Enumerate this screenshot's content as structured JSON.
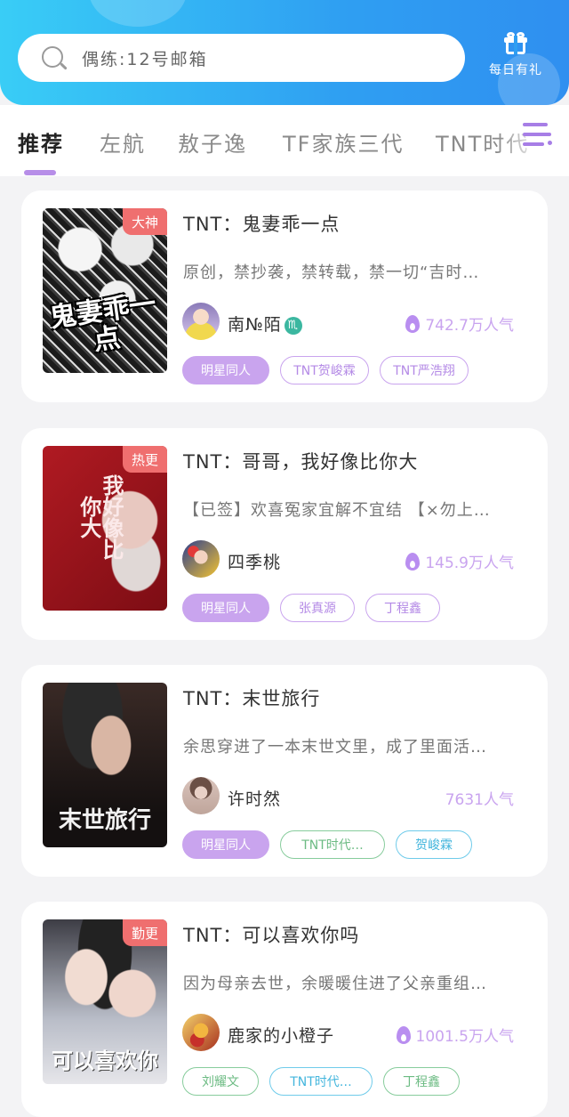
{
  "header": {
    "search_placeholder": "偶练:12号邮箱",
    "gift_label": "每日有礼",
    "icons": {
      "search": "search-icon",
      "gift": "gift-icon"
    }
  },
  "tabs": [
    {
      "label": "推荐",
      "active": true
    },
    {
      "label": "左航",
      "active": false
    },
    {
      "label": "敖子逸",
      "active": false
    },
    {
      "label": "TF家族三代",
      "active": false
    },
    {
      "label": "TNT时代",
      "active": false
    }
  ],
  "books": [
    {
      "badge": "大神",
      "cover_text": "鬼妻乖一点",
      "title": "TNT：鬼妻乖一点",
      "desc": "原创，禁抄袭，禁转载，禁一切“吉时…",
      "author": "南№陌",
      "author_badge": "♏",
      "popularity": "742.7万人气",
      "tags": [
        "明星同人",
        "TNT贺峻霖",
        "TNT严浩翔"
      ]
    },
    {
      "badge": "热更",
      "cover_text": "我好像比你大",
      "title": "TNT：哥哥，我好像比你大",
      "desc": "【已签】欢喜冤家宜解不宜结 【×勿上…",
      "author": "四季桃",
      "popularity": "145.9万人气",
      "tags": [
        "明星同人",
        "张真源",
        "丁程鑫"
      ]
    },
    {
      "badge": "",
      "cover_text": "末世旅行",
      "title": "TNT：末世旅行",
      "desc": "余思穿进了一本末世文里，成了里面活…",
      "author": "许时然",
      "popularity": "7631人气",
      "tags": [
        "明星同人",
        "TNT时代…",
        "贺峻霖"
      ]
    },
    {
      "badge": "勤更",
      "cover_text": "可以喜欢你",
      "title": "TNT：可以喜欢你吗",
      "desc": "因为母亲去世，余暖暖住进了父亲重组…",
      "author": "鹿家的小橙子",
      "popularity": "1001.5万人气",
      "tags": [
        "刘耀文",
        "TNT时代…",
        "丁程鑫"
      ]
    }
  ],
  "colors": {
    "header_start": "#39cdf6",
    "header_end": "#2f8ff0",
    "accent_purple": "#c9a4ee",
    "badge_red": "#ef6f6f",
    "tag_green": "#87cc9c",
    "tag_blue": "#6fcbea"
  }
}
